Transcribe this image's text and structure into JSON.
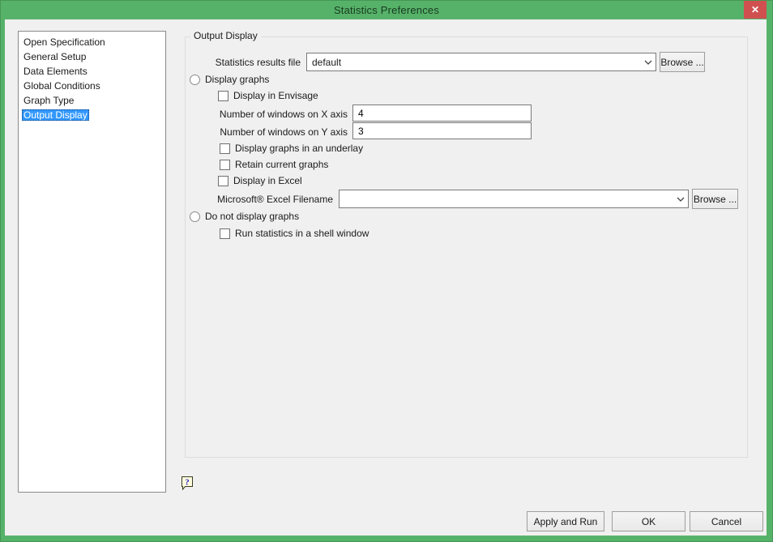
{
  "window": {
    "title": "Statistics Preferences",
    "close_glyph": "✕"
  },
  "colors": {
    "frame_green": "#57b269",
    "close_red": "#d05050",
    "selection_blue": "#3298fd",
    "dialog_bg": "#f0f0f0"
  },
  "sidebar": {
    "items": [
      {
        "label": "Open Specification",
        "selected": false
      },
      {
        "label": "General Setup",
        "selected": false
      },
      {
        "label": "Data Elements",
        "selected": false
      },
      {
        "label": "Global Conditions",
        "selected": false
      },
      {
        "label": "Graph Type",
        "selected": false
      },
      {
        "label": "Output Display",
        "selected": true
      }
    ]
  },
  "main": {
    "group_title": "Output Display",
    "results_file": {
      "label": "Statistics results file",
      "value": "default",
      "browse_label": "Browse ..."
    },
    "display_graphs": {
      "label": "Display graphs",
      "selected": false,
      "envisage": {
        "label": "Display in Envisage",
        "checked": false
      },
      "windows_x": {
        "label": "Number of windows on X axis",
        "value": "4"
      },
      "windows_y": {
        "label": "Number of windows on Y axis",
        "value": "3"
      },
      "underlay": {
        "label": "Display graphs in an underlay",
        "checked": false
      },
      "retain": {
        "label": "Retain current graphs",
        "checked": false
      },
      "excel": {
        "label": "Display in Excel",
        "checked": false
      },
      "excel_file": {
        "label": "Microsoft® Excel Filename",
        "value": "",
        "browse_label": "Browse ..."
      }
    },
    "no_graphs": {
      "label": "Do not display graphs",
      "selected": false,
      "shell": {
        "label": "Run statistics in a shell window",
        "checked": false
      }
    }
  },
  "footer": {
    "apply_label": "Apply and Run",
    "ok_label": "OK",
    "cancel_label": "Cancel"
  }
}
